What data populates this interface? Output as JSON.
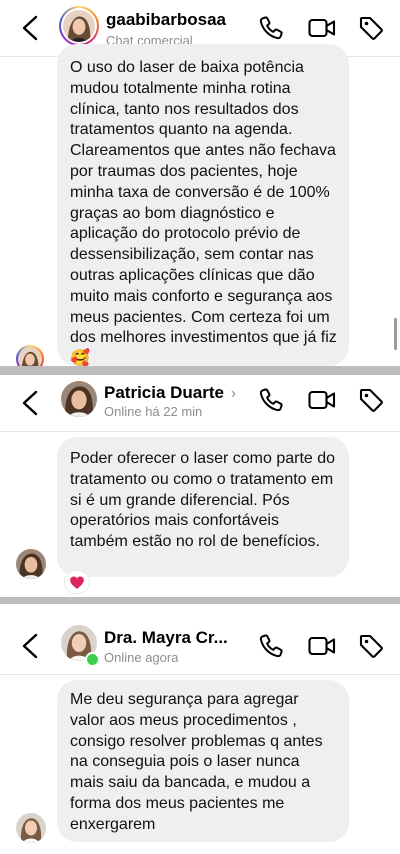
{
  "panels": [
    {
      "contact_name": "gaabibarbosaa",
      "contact_subtitle": "Chat comercial",
      "message": "O uso do laser de baixa potência mudou totalmente minha rotina clínica, tanto nos resultados dos tratamentos quanto na agenda. Clareamentos que antes não fechava por traumas dos pacientes, hoje minha taxa de conversão é de 100% graças ao bom diagnóstico e aplicação do protocolo prévio de dessensibilização, sem contar nas outras aplicações clínicas que dão muito mais conforto e segurança aos meus pacientes. Com certeza foi um dos melhores investimentos que já fiz 🥰"
    },
    {
      "contact_name": "Patricia Duarte",
      "contact_subtitle": "Online há 22 min",
      "message": "Poder oferecer o laser como parte do tratamento ou como o tratamento em si é um grande diferencial. Pós operatórios mais confortáveis também estão no rol de benefícios.",
      "reaction": "❤️"
    },
    {
      "contact_name": "Dra. Mayra Cr...",
      "contact_subtitle": "Online agora",
      "message": "Me deu segurança para agregar valor aos meus procedimentos , consigo resolver problemas q antes na conseguia pois o laser nunca mais saiu da bancada, e mudou a forma dos meus pacientes me enxergarem"
    }
  ],
  "icons": {
    "back": "chevron-left-icon",
    "call": "phone-icon",
    "video": "video-camera-icon",
    "tag": "tag-icon",
    "profile_arrow": "chevron-right-icon"
  },
  "colors": {
    "bubble": "#efefef",
    "online": "#3ccf4e",
    "divider": "#bdbdbd",
    "heart": "#e0245e"
  }
}
